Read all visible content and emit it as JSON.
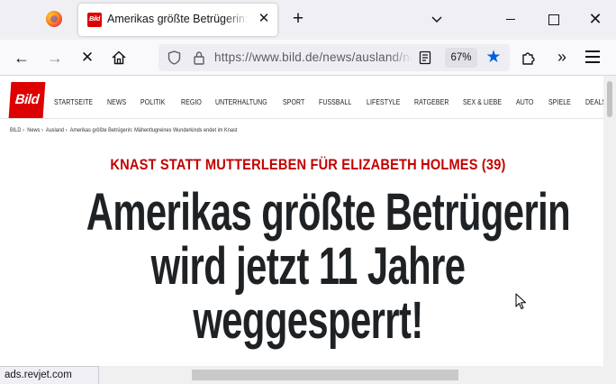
{
  "browser": {
    "tab": {
      "favicon_text": "Bild",
      "title": "Amerikas größte Betrügerin: Holmes",
      "close": "✕"
    },
    "new_tab": "+",
    "window_controls": {
      "close": "✕"
    },
    "nav": {
      "back": "←",
      "forward": "→",
      "stop": "✕",
      "url": "https://www.bild.de/news/ausland/news-ausland/amerikas-groesste-betruegerin",
      "zoom": "67%",
      "star": "★",
      "overflow": "»"
    },
    "status_url": "ads.revjet.com"
  },
  "site": {
    "logo_text": "Bild",
    "brand_color": "#dd0000",
    "nav_items": [
      "STARTSEITE",
      "NEWS",
      "POLITIK",
      "REGIO",
      "UNTERHALTUNG",
      "SPORT",
      "FUSSBALL",
      "LIFESTYLE",
      "RATGEBER",
      "SEX & LIEBE",
      "AUTO",
      "SPIELE",
      "DEALS"
    ],
    "breadcrumb": [
      "BILD",
      "News",
      "Ausland",
      "Amerikas größte Betrügerin: Mähentlugreines Wunderkinds endet im Knast"
    ],
    "breadcrumb_sep": "›",
    "kicker": "KNAST STATT MUTTERLEBEN FÜR ELIZABETH HOLMES (39)",
    "kicker_color": "#c30000",
    "headline_lines": [
      "Amerikas größte Betrügerin",
      "wird jetzt 11 Jahre",
      "weggesperrt!"
    ]
  }
}
